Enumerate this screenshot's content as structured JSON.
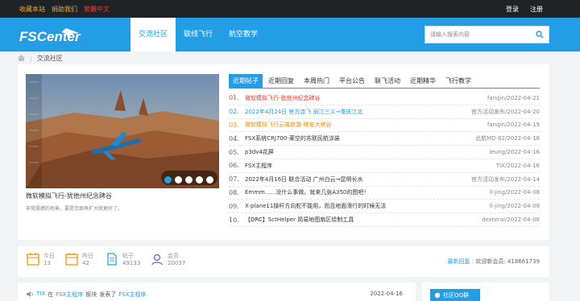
{
  "topbar": {
    "links": [
      {
        "label": "收藏本站",
        "color": "#f3a62b"
      },
      {
        "label": "捐助我们",
        "color": "#f3a62b"
      },
      {
        "label": "繁體中文",
        "color": "#e43b2c"
      }
    ],
    "login": "登录",
    "register": "注册"
  },
  "navbar": {
    "brand": "FSCenter",
    "items": [
      "交流社区",
      "联线飞行",
      "航空教学"
    ],
    "active_index": 0
  },
  "search": {
    "placeholder": "请输入搜索内容"
  },
  "breadcrumb": {
    "current": "交流社区"
  },
  "slider": {
    "caption": "微软模拟飞行-犹他州纪念碑谷",
    "sub": "非常震撼的地景，要是您面再扩大就更好了。",
    "dots": 5,
    "active_dot": 0
  },
  "tabs": [
    "近期帖子",
    "近期回复",
    "本周热门",
    "平台公告",
    "联飞活动",
    "近期精华",
    "飞行教学"
  ],
  "posts": [
    {
      "num": "01.",
      "title": "微软模拟飞行-犹他州纪念碑谷",
      "meta": "fanqin/2022-04-21",
      "color": "#e43b2c",
      "num_color": "#e43b2c"
    },
    {
      "num": "02.",
      "title": "2022年4月24日 官方连飞 丽江三义→重庆江北",
      "meta": "官方活动发布/2022-04-20",
      "color": "#239de5",
      "num_color": "#239de5"
    },
    {
      "num": "03.",
      "title": "微软模拟飞行云端旅游-喀安大峡谷",
      "meta": "fanqin/2022-04-19",
      "color": "#f08c00",
      "num_color": "#f08c00"
    },
    {
      "num": "04.",
      "title": "FSX系统CRJ700-莱空的苏联民航涂装",
      "meta": "北航MD-82/2022-04-18",
      "color": "#333",
      "num_color": "#555"
    },
    {
      "num": "05.",
      "title": "p3dv4花屏",
      "meta": "leung/2022-04-16",
      "color": "#333",
      "num_color": "#555"
    },
    {
      "num": "06.",
      "title": "FSX主程序",
      "meta": "TIX/2022-04-16",
      "color": "#333",
      "num_color": "#555"
    },
    {
      "num": "07.",
      "title": "2022年4月16日 联合活动 广州白云→昆明长水",
      "meta": "官方活动发布/2022-04-14",
      "color": "#333",
      "num_color": "#555"
    },
    {
      "num": "08.",
      "title": "Emmm......没什么事做。就来几张A350的图吧！",
      "meta": "ll-jing/2022-04-08",
      "color": "#333",
      "num_color": "#555"
    },
    {
      "num": "09.",
      "title": "X-plane11操杆方向舵不能用，而且地面滑行的时候无法",
      "meta": "ll-jing/2022-04-08",
      "color": "#333",
      "num_color": "#555"
    },
    {
      "num": "10.",
      "title": "【DRC】SctHelper 简易地图扇区绘制工具",
      "meta": "dexterai/2022-04-08",
      "color": "#333",
      "num_color": "#555"
    }
  ],
  "stats": {
    "today": {
      "label": "今日",
      "value": "13"
    },
    "yesterday": {
      "label": "昨日",
      "value": "42"
    },
    "posts": {
      "label": "帖子",
      "value": "49133"
    },
    "members": {
      "label": "会员",
      "value": "20037"
    },
    "latest_reply": "最新回复",
    "welcome": "欢迎新会员: 418661739"
  },
  "activity": {
    "user": "TIX",
    "in": "在",
    "board": "FSX主程序",
    "board_word": "板块",
    "action": "发表了",
    "post": "FSX主程序",
    "date": "2022-04-16"
  },
  "qq_group": "社区QQ群",
  "colors": {
    "accent": "#239de5",
    "topbar": "#1f2326"
  }
}
